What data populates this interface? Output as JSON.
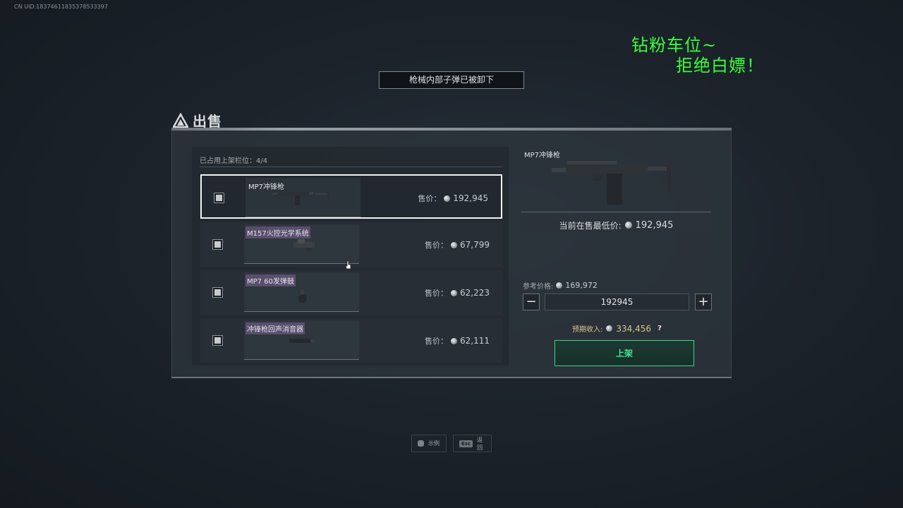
{
  "uid": "CN UID:18374611835378533397",
  "overlay": {
    "line1": "钻粉车位~",
    "line2": "拒绝白嫖！"
  },
  "notice": "枪械内部子弹已被卸下",
  "panel_title": "出售",
  "slots_label": "已占用上架栏位：4/4",
  "price_prefix": "售价：",
  "items": [
    {
      "name": "MP7冲锋枪",
      "price": "192,945",
      "selected": true
    },
    {
      "name": "M157火控光学系统",
      "price": "67,799",
      "selected": false
    },
    {
      "name": "MP7 60发弹鼓",
      "price": "62,223",
      "selected": false
    },
    {
      "name": "冲锋枪回声消音器",
      "price": "62,111",
      "selected": false
    }
  ],
  "detail": {
    "name": "MP7冲锋枪",
    "lowest_label": "当前在售最低价:",
    "lowest_value": "192,945",
    "ref_label": "参考价格:",
    "ref_value": "169,972",
    "quantity": "192945",
    "income_label": "预期收入:",
    "income_value": "334,456",
    "help": "?",
    "list_button": "上架"
  },
  "footer": {
    "example_label": "示例",
    "esc_key": "Esc",
    "back_label": "返回"
  },
  "colors": {
    "accent": "#43e592",
    "overlay": "#39ff39",
    "income": "#d8c88a",
    "tag": "#5a4e6d"
  }
}
